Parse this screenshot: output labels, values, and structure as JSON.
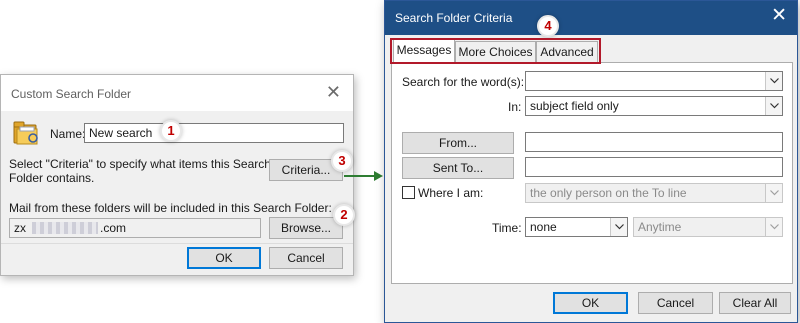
{
  "custom_dialog": {
    "title": "Custom Search Folder",
    "name_label": "Name:",
    "name_value": "New search",
    "criteria_text_line1": "Select \"Criteria\" to specify what items this Search",
    "criteria_text_line2": "Folder contains.",
    "criteria_button": "Criteria...",
    "folders_label": "Mail from these folders will be included in this Search Folder:",
    "folder_value_prefix": "zx",
    "folder_value_suffix": ".com",
    "browse_button": "Browse...",
    "ok_button": "OK",
    "cancel_button": "Cancel",
    "close_glyph": "✕"
  },
  "criteria_dialog": {
    "title": "Search Folder Criteria",
    "close_glyph": "✕",
    "tabs": [
      {
        "label": "Messages",
        "active": true
      },
      {
        "label": "More Choices",
        "active": false
      },
      {
        "label": "Advanced",
        "active": false
      }
    ],
    "search_words_label": "Search for the word(s):",
    "search_words_value": "",
    "in_label": "In:",
    "in_value": "subject field only",
    "from_button": "From...",
    "sent_to_button": "Sent To...",
    "where_label": "Where I am:",
    "where_value": "the only person on the To line",
    "time_label": "Time:",
    "time_value": "none",
    "time_range_value": "Anytime",
    "ok_button": "OK",
    "cancel_button": "Cancel",
    "clear_all_button": "Clear All"
  },
  "badges": [
    "1",
    "2",
    "3",
    "4"
  ],
  "colors": {
    "badge_text": "#c00000",
    "highlight_border": "#b2192a",
    "arrow": "#2e7d32",
    "title_bar_active": "#1e4f86"
  }
}
